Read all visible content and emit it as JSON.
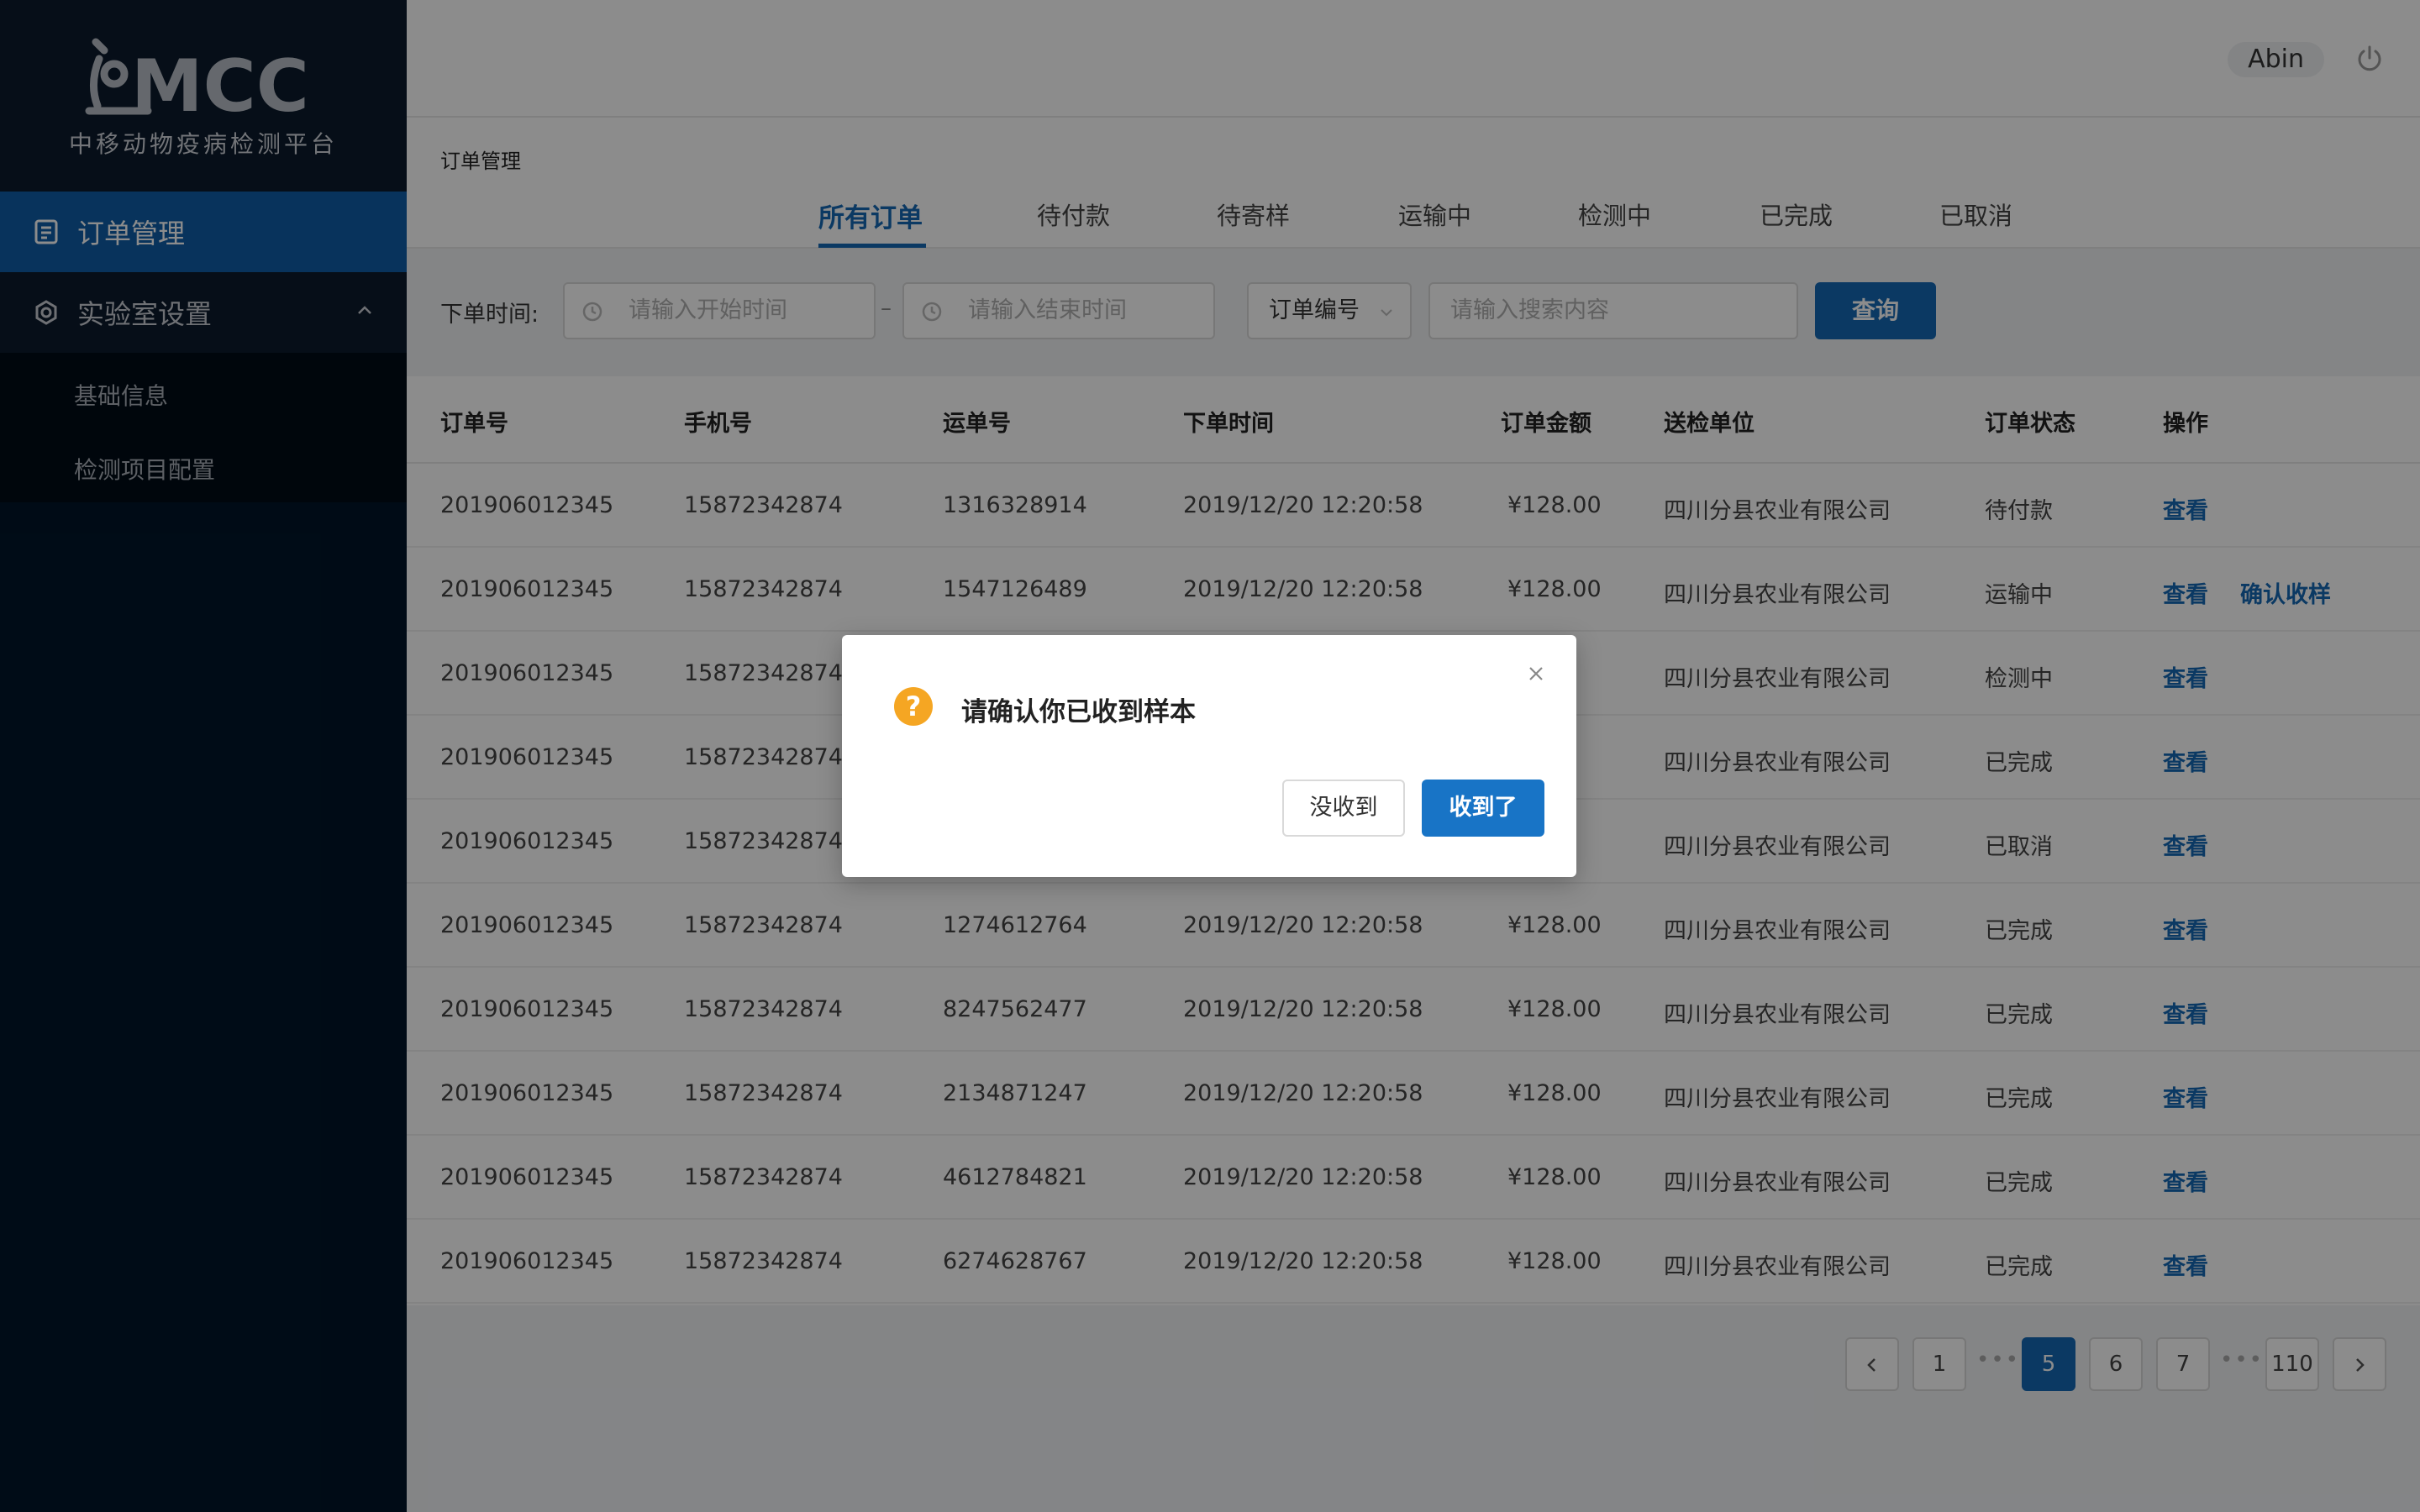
{
  "app": {
    "logo_text": "MCC",
    "logo_subtitle": "中移动物疫病检测平台"
  },
  "sidebar": {
    "items": [
      {
        "label": "订单管理",
        "icon": "document-icon",
        "active": true
      },
      {
        "label": "实验室设置",
        "icon": "settings-icon",
        "expanded": true
      }
    ],
    "subitems": [
      "基础信息",
      "检测项目配置"
    ]
  },
  "header": {
    "user": "Abin",
    "power_icon": "power-icon"
  },
  "breadcrumb": "订单管理",
  "tabs": [
    "所有订单",
    "待付款",
    "待寄样",
    "运输中",
    "检测中",
    "已完成",
    "已取消"
  ],
  "filters": {
    "time_label": "下单时间:",
    "start_placeholder": "请输入开始时间",
    "end_placeholder": "请输入结束时间",
    "separator": "–",
    "select_value": "订单编号",
    "search_placeholder": "请输入搜索内容",
    "query_label": "查询"
  },
  "table": {
    "headers": [
      "订单号",
      "手机号",
      "运单号",
      "下单时间",
      "订单金额",
      "送检单位",
      "订单状态",
      "操作"
    ],
    "rows": [
      [
        "201906012345",
        "15872342874",
        "1316328914",
        "2019/12/20 12:20:58",
        "¥128.00",
        "四川分县农业有限公司",
        "待付款",
        "查看",
        ""
      ],
      [
        "201906012345",
        "15872342874",
        "1547126489",
        "2019/12/20 12:20:58",
        "¥128.00",
        "四川分县农业有限公司",
        "运输中",
        "查看",
        "确认收样"
      ],
      [
        "201906012345",
        "15872342874",
        "",
        "",
        "",
        "四川分县农业有限公司",
        "检测中",
        "查看",
        ""
      ],
      [
        "201906012345",
        "15872342874",
        "",
        "",
        "",
        "四川分县农业有限公司",
        "已完成",
        "查看",
        ""
      ],
      [
        "201906012345",
        "15872342874",
        "",
        "",
        "",
        "四川分县农业有限公司",
        "已取消",
        "查看",
        ""
      ],
      [
        "201906012345",
        "15872342874",
        "1274612764",
        "2019/12/20 12:20:58",
        "¥128.00",
        "四川分县农业有限公司",
        "已完成",
        "查看",
        ""
      ],
      [
        "201906012345",
        "15872342874",
        "8247562477",
        "2019/12/20 12:20:58",
        "¥128.00",
        "四川分县农业有限公司",
        "已完成",
        "查看",
        ""
      ],
      [
        "201906012345",
        "15872342874",
        "2134871247",
        "2019/12/20 12:20:58",
        "¥128.00",
        "四川分县农业有限公司",
        "已完成",
        "查看",
        ""
      ],
      [
        "201906012345",
        "15872342874",
        "4612784821",
        "2019/12/20 12:20:58",
        "¥128.00",
        "四川分县农业有限公司",
        "已完成",
        "查看",
        ""
      ],
      [
        "201906012345",
        "15872342874",
        "6274628767",
        "2019/12/20 12:20:58",
        "¥128.00",
        "四川分县农业有限公司",
        "已完成",
        "查看",
        ""
      ]
    ]
  },
  "pagination": {
    "pages": [
      "1",
      "5",
      "6",
      "7",
      "110"
    ],
    "current": "5",
    "dots": "•••"
  },
  "modal": {
    "icon": "question-icon",
    "icon_glyph": "?",
    "title": "请确认你已收到样本",
    "cancel_label": "没收到",
    "confirm_label": "收到了"
  },
  "colors": {
    "sidebar_bg": "#001529",
    "accent": "#1468b5",
    "modal_confirm": "#1874c6",
    "warning": "#f5a623"
  }
}
